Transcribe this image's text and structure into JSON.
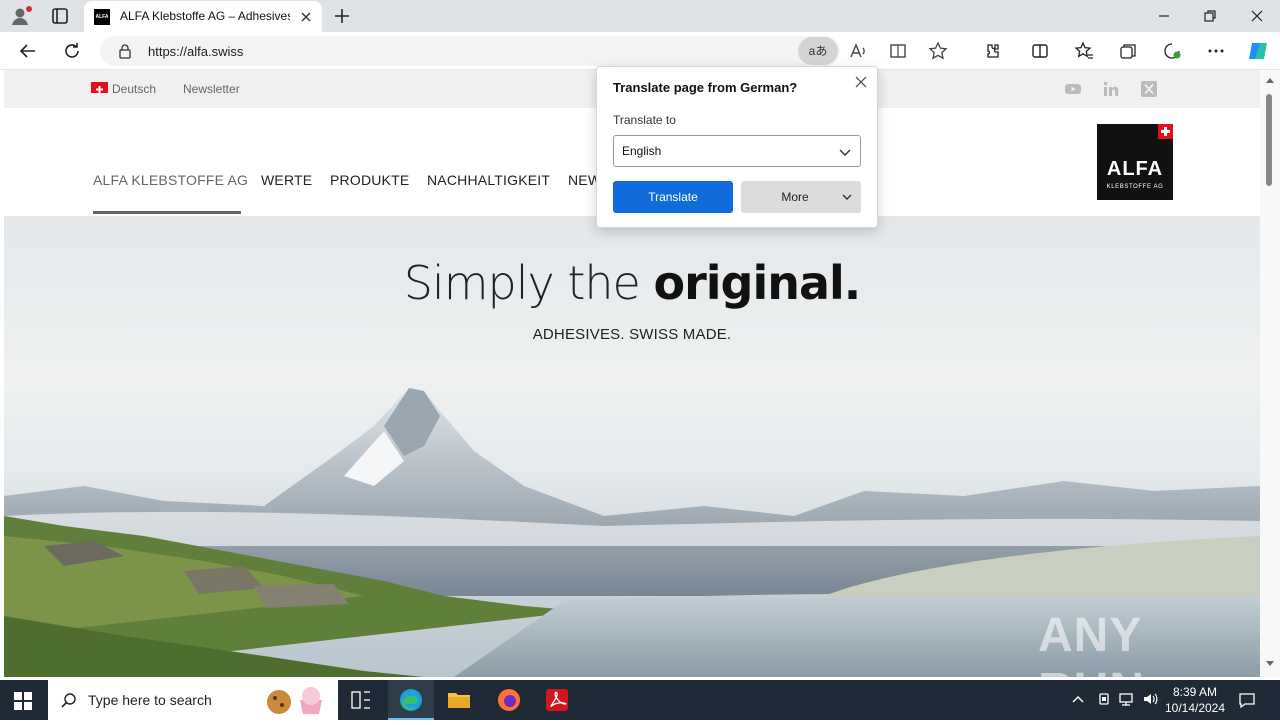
{
  "browser": {
    "tab_title": "ALFA Klebstoffe AG – Adhesives...",
    "tab_favicon_text": "ALFA",
    "url": "https://alfa.swiss",
    "translate_badge": "aあ"
  },
  "site": {
    "top_links": {
      "language": "Deutsch",
      "newsletter": "Newsletter"
    },
    "menu": [
      "ALFA KLEBSTOFFE AG",
      "WERTE",
      "PRODUKTE",
      "NACHHALTIGKEIT",
      "NEW"
    ],
    "logo": {
      "text": "ALFA",
      "sub": "KLEBSTOFFE AG"
    },
    "hero": {
      "headline_light": "Simply the ",
      "headline_bold": "original.",
      "subline": "ADHESIVES. SWISS MADE."
    },
    "watermark": "ANY RUN"
  },
  "translate_popup": {
    "title": "Translate page from German?",
    "label": "Translate to",
    "selected_language": "English",
    "translate_button": "Translate",
    "more_button": "More"
  },
  "taskbar": {
    "search_placeholder": "Type here to search",
    "time": "8:39 AM",
    "date": "10/14/2024"
  },
  "colors": {
    "accent_blue": "#0f6cd9",
    "swiss_red": "#e3101b",
    "taskbar_bg": "#1f2a36"
  }
}
